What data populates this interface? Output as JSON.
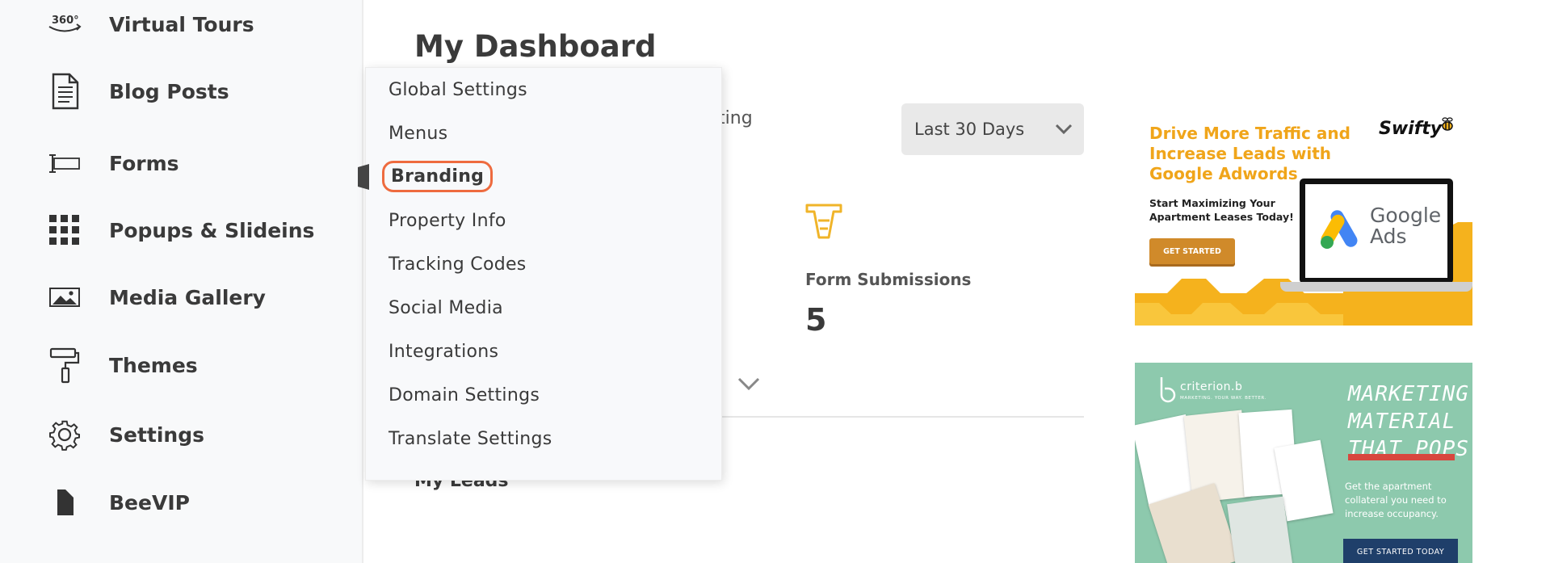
{
  "sidebar": {
    "items": [
      {
        "label": "Virtual Tours",
        "icon": "360-icon"
      },
      {
        "label": "Blog Posts",
        "icon": "document-icon"
      },
      {
        "label": "Forms",
        "icon": "form-field-icon"
      },
      {
        "label": "Popups & Slideins",
        "icon": "grid-icon"
      },
      {
        "label": "Media Gallery",
        "icon": "image-icon"
      },
      {
        "label": "Themes",
        "icon": "paint-roller-icon"
      },
      {
        "label": "Settings",
        "icon": "gear-icon"
      },
      {
        "label": "BeeVIP",
        "icon": "flag-icon"
      }
    ]
  },
  "settings_menu": {
    "items": [
      "Global Settings",
      "Menus",
      "Branding",
      "Property Info",
      "Tracking Codes",
      "Social Media",
      "Integrations",
      "Domain Settings",
      "Translate Settings"
    ],
    "active": "Branding"
  },
  "main": {
    "title": "My Dashboard",
    "partial_text": "rting",
    "date_range": "Last 30 Days",
    "stat": {
      "label": "Form Submissions",
      "value": "5"
    },
    "leads_title": "My Leads"
  },
  "ads": {
    "ad1": {
      "headline": "Drive More Traffic and Increase Leads with Google Adwords",
      "brand": "Swifty",
      "subhead": "Start Maximizing Your Apartment Leases Today!",
      "button": "GET STARTED",
      "product": "Google Ads"
    },
    "ad2": {
      "brand": "criterion.b",
      "brand_sub": "MARKETING. YOUR WAY. BETTER.",
      "headline": "MARKETING MATERIAL THAT POPS",
      "body": "Get the apartment collateral you need to increase occupancy.",
      "button": "GET STARTED TODAY"
    }
  },
  "colors": {
    "accent_orange": "#ee6b3f",
    "ad_yellow": "#f5b21d",
    "ad_green": "#8dc9ad",
    "ad_navy": "#1f3f6a"
  }
}
